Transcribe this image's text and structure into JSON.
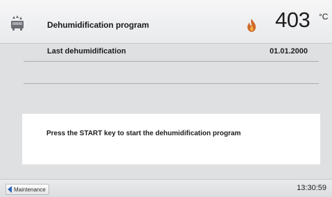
{
  "header": {
    "program_icon": "dehumidification-program-icon",
    "title": "Dehumidification program",
    "heater_icon": "flame-icon",
    "temperature_value": "403",
    "temperature_unit": "°C"
  },
  "info": {
    "last_dehumidification_label": "Last dehumidification",
    "last_dehumidification_value": "01.01.2000"
  },
  "message": {
    "text": "Press the START key to start the dehumidification program"
  },
  "footer": {
    "back_icon": "back-arrow-icon",
    "back_label": "Maintenance",
    "time": "13:30:59"
  },
  "colors": {
    "accent_blue": "#2a64b8",
    "flame_orange": "#d06a2a",
    "background": "#dfe0e2"
  }
}
